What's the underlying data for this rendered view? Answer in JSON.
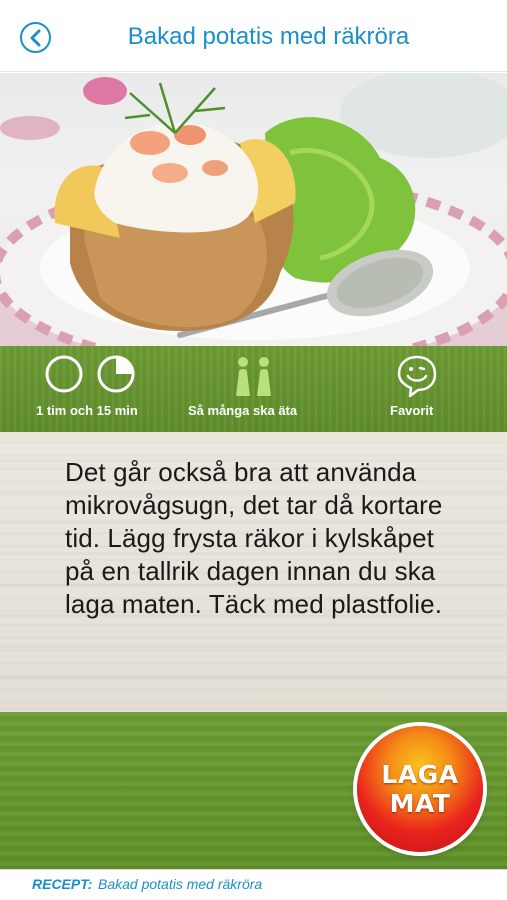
{
  "header": {
    "title": "Bakad potatis med räkröra",
    "back_icon": "chevron-left-icon",
    "accent_color": "#1a8fc9"
  },
  "photo": {
    "subject": "baked potato with shrimp salad"
  },
  "info": {
    "time_label": "1 tim och 15 min",
    "servings_label": "Så många ska äta",
    "favorite_label": "Favorit",
    "icons": [
      "clock-empty-icon",
      "clock-quarter-icon",
      "people-icon",
      "smiley-icon"
    ]
  },
  "instructions": {
    "text": "Det går också bra att använda mikrovågsugn, det tar då kortare tid. Lägg frysta räkor i kylskåpet på en tallrik dagen innan du ska laga maten. Täck med plastfolie."
  },
  "cook_button": {
    "line1": "LAGA",
    "line2": "MAT"
  },
  "footer": {
    "label": "RECEPT:",
    "recipe_name": "Bakad potatis med räkröra"
  }
}
